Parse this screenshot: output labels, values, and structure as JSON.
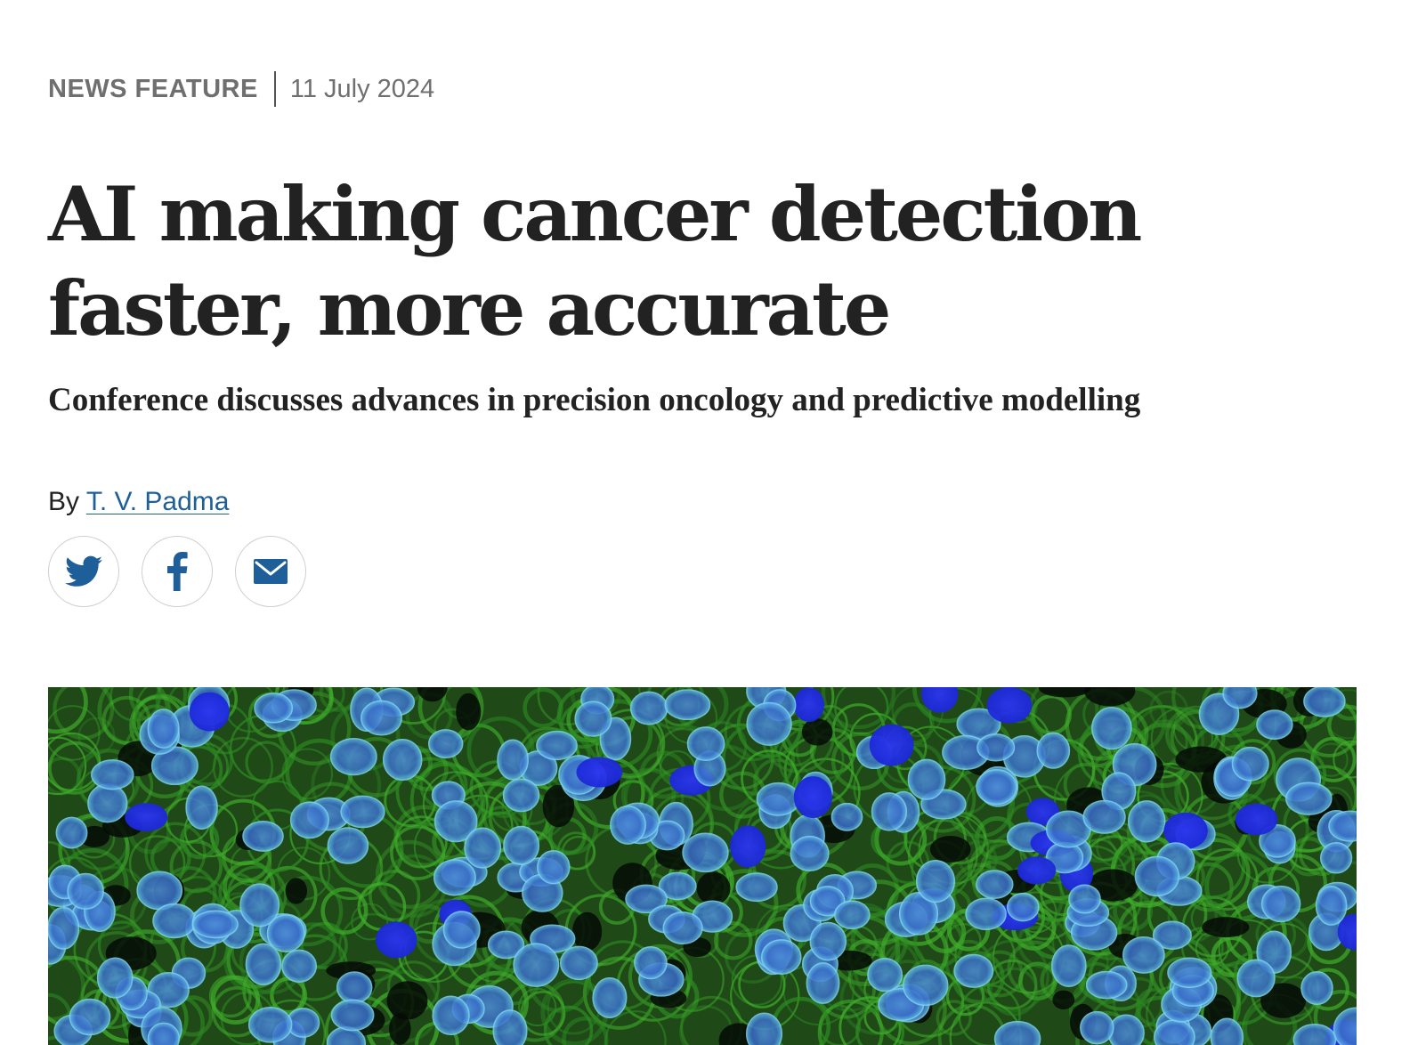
{
  "article": {
    "type_label": "NEWS FEATURE",
    "date": "11 July 2024",
    "headline": "AI making cancer detection faster, more accurate",
    "standfirst": "Conference discusses advances in precision oncology and predictive modelling",
    "byline_prefix": "By",
    "author": "T. V. Padma"
  },
  "share": {
    "buttons": [
      {
        "icon": "twitter-icon",
        "label": "Share on Twitter"
      },
      {
        "icon": "facebook-icon",
        "label": "Share on Facebook"
      },
      {
        "icon": "mail-icon",
        "label": "Share by email"
      }
    ]
  },
  "colors": {
    "link": "#1f5f99",
    "icon": "#1f5f99",
    "meta": "#6f6f6f",
    "text": "#222222",
    "cell_membrane": "#3fae2a",
    "nucleus": "#2a3fe0"
  }
}
